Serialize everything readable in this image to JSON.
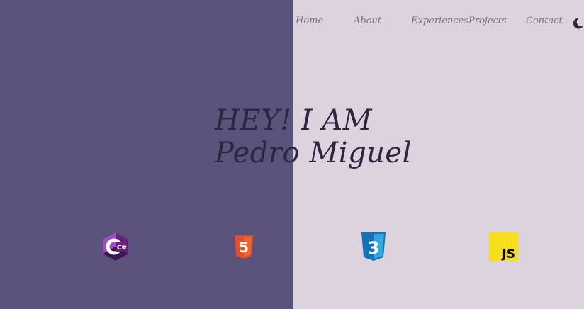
{
  "nav": {
    "items": [
      {
        "label": "Home"
      },
      {
        "label": "About"
      },
      {
        "label": "Experiences"
      },
      {
        "label": "Projects"
      },
      {
        "label": "Contact"
      }
    ],
    "theme_toggle_icon": "moon-icon"
  },
  "hero": {
    "line1": "HEY! I AM",
    "line2": "Pedro Miguel"
  },
  "tech": {
    "items": [
      {
        "icon": "csharp-icon",
        "glyph": "C#"
      },
      {
        "icon": "html5-icon",
        "glyph": "5"
      },
      {
        "icon": "css3-icon",
        "glyph": "3"
      },
      {
        "icon": "javascript-icon",
        "glyph": "JS"
      }
    ]
  },
  "colors": {
    "left_panel": "#5a527a",
    "right_panel": "#ddd3df",
    "text_dark": "#2e2640",
    "nav_text": "#7a6f8c"
  }
}
